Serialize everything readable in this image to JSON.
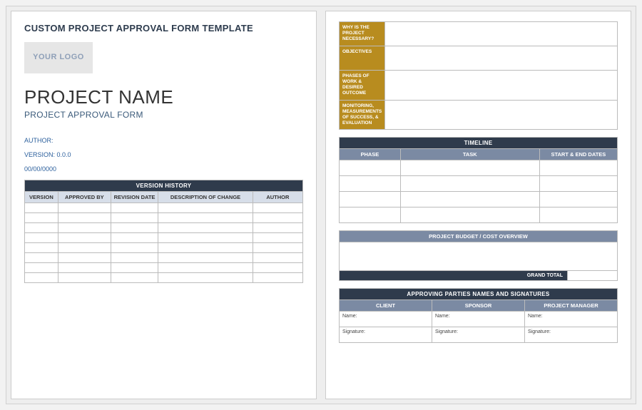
{
  "left": {
    "caption": "CUSTOM PROJECT APPROVAL FORM TEMPLATE",
    "logo": "YOUR LOGO",
    "project_name": "PROJECT NAME",
    "subtitle": "PROJECT APPROVAL FORM",
    "author_label": "AUTHOR:",
    "version_label": "VERSION: 0.0.0",
    "date_label": "00/00/0000",
    "version_history": {
      "title": "VERSION HISTORY",
      "cols": [
        "VERSION",
        "APPROVED BY",
        "REVISION DATE",
        "DESCRIPTION OF CHANGE",
        "AUTHOR"
      ]
    }
  },
  "right": {
    "side_labels": [
      "WHY IS THE PROJECT NECESSARY?",
      "OBJECTIVES",
      "PHASES OF WORK & DESIRED OUTCOME",
      "MONITORING, MEASUREMENTS OF SUCCESS, & EVALUATION"
    ],
    "timeline": {
      "title": "TIMELINE",
      "cols": [
        "PHASE",
        "TASK",
        "START & END DATES"
      ]
    },
    "budget_title": "PROJECT BUDGET / COST OVERVIEW",
    "grand_total_label": "GRAND TOTAL",
    "approving": {
      "title": "APPROVING PARTIES NAMES AND SIGNATURES",
      "cols": [
        "CLIENT",
        "SPONSOR",
        "PROJECT MANAGER"
      ],
      "name_label": "Name:",
      "sig_label": "Signature:"
    }
  }
}
